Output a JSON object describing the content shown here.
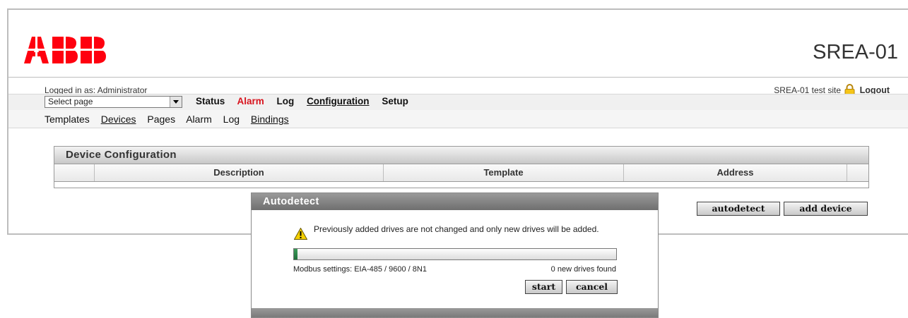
{
  "header": {
    "brand": "ABB",
    "site_title": "SREA-01",
    "colors": {
      "brand_red": "#ff000f",
      "alarm_red": "#d8131d"
    }
  },
  "userbar": {
    "logged_in": "Logged in as: Administrator",
    "site_name": "SREA-01 test site",
    "lock_icon": "lock-icon",
    "logout": "Logout"
  },
  "menubar": {
    "select_value": "Select page",
    "items": [
      {
        "label": "Status"
      },
      {
        "label": "Alarm"
      },
      {
        "label": "Log"
      },
      {
        "label": "Configuration"
      },
      {
        "label": "Setup"
      }
    ]
  },
  "subnav": {
    "items": [
      {
        "label": "Templates"
      },
      {
        "label": "Devices"
      },
      {
        "label": "Pages"
      },
      {
        "label": "Alarm"
      },
      {
        "label": "Log"
      },
      {
        "label": "Bindings"
      }
    ]
  },
  "device_panel": {
    "title": "Device Configuration",
    "columns": [
      "Description",
      "Template",
      "Address"
    ],
    "buttons": {
      "autodetect": "autodetect",
      "add_device": "add device"
    }
  },
  "autodetect_dialog": {
    "title": "Autodetect",
    "warning_icon": "warning-icon",
    "warning": "Previously added drives are not changed and only new drives will be added.",
    "progress": 0.01,
    "modbus_settings": "Modbus settings: EIA-485 / 9600 / 8N1",
    "found": "0 new drives found",
    "buttons": {
      "start": "start",
      "cancel": "cancel"
    }
  }
}
